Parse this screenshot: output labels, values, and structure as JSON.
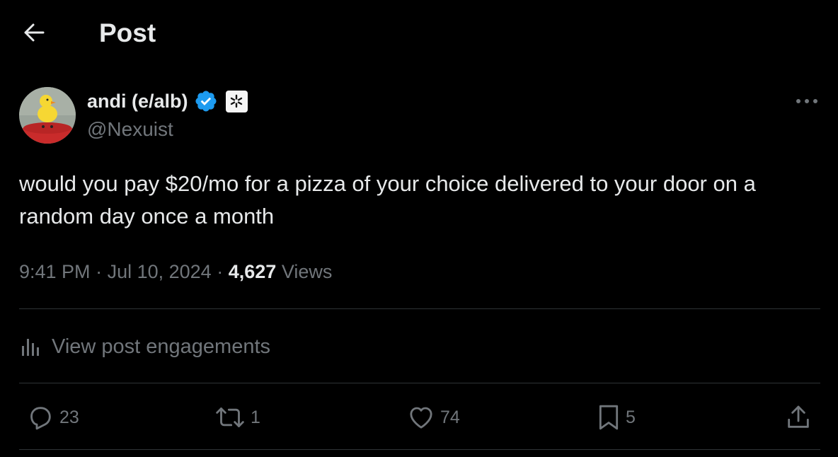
{
  "header": {
    "title": "Post",
    "back_icon": "arrow-left-icon"
  },
  "author": {
    "display_name": "andi (e/alb)",
    "handle": "@Nexuist",
    "verified_icon": "verified-badge-icon",
    "affiliate_icon": "asterisk-badge-icon"
  },
  "tweet": {
    "text": "would you pay $20/mo for a pizza of your choice delivered to your door on a random day once a month",
    "time": "9:41 PM",
    "date": "Jul 10, 2024",
    "views_count": "4,627",
    "views_label": "Views"
  },
  "engagements": {
    "label": "View post engagements",
    "icon": "bar-chart-icon"
  },
  "actions": {
    "replies": "23",
    "reposts": "1",
    "likes": "74",
    "bookmarks": "5"
  },
  "colors": {
    "background": "#000000",
    "text": "#e7e9ea",
    "muted": "#71767b",
    "divider": "#2f3336",
    "verified": "#1d9bf0"
  }
}
